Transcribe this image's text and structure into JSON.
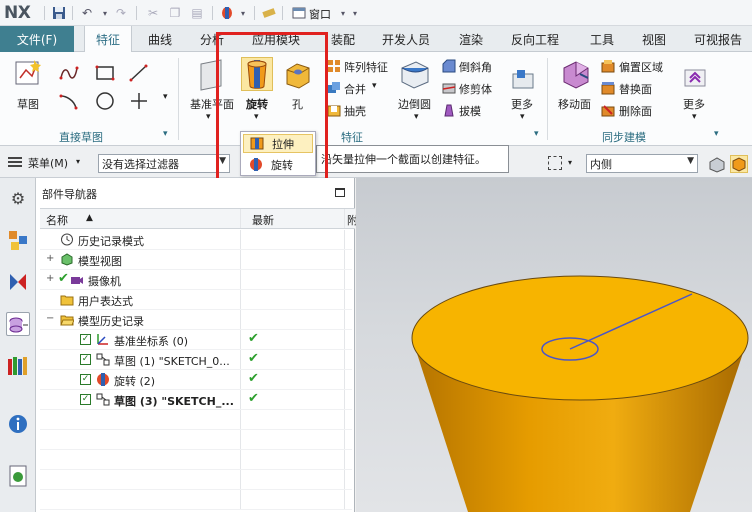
{
  "app": {
    "logo": "NX",
    "window_menu": "窗口"
  },
  "tabs": [
    "文件(F)",
    "特征",
    "曲线",
    "分析",
    "应用模块",
    "装配",
    "开发人员",
    "渲染",
    "反向工程",
    "工具",
    "视图",
    "可视报告"
  ],
  "ribbon": {
    "sketch_label": "草图",
    "direct_sketch_group": "直接草图",
    "datum_plane_label": "基准平面",
    "revolve_label": "旋转",
    "hole_label": "孔",
    "array_feature": "阵列特征",
    "unite": "合并",
    "shell": "抽壳",
    "edge_blend": "边倒圆",
    "chamfer": "倒斜角",
    "trim_body": "修剪体",
    "draft": "拔模",
    "more1": "更多",
    "feature_group": "特征",
    "move_face": "移动面",
    "offset_region": "偏置区域",
    "replace_face": "替换面",
    "delete_face": "删除面",
    "more2": "更多",
    "sync_group": "同步建模"
  },
  "dropdown": {
    "items": [
      "拉伸",
      "旋转"
    ]
  },
  "tooltip": "沿矢量拉伸一个截面以创建特征。",
  "selbar": {
    "menu": "菜单(M)",
    "filter": "没有选择过滤器",
    "scope": "内侧"
  },
  "navigator": {
    "title": "部件导航器",
    "col_name": "名称",
    "col_latest": "最新",
    "col_extra": "附",
    "rows": [
      {
        "label": "历史记录模式",
        "checked": false,
        "latest": false
      },
      {
        "label": "模型视图",
        "checked": false,
        "latest": false
      },
      {
        "label": "摄像机",
        "checked": false,
        "latest": false
      },
      {
        "label": "用户表达式",
        "checked": false,
        "latest": false
      },
      {
        "label": "模型历史记录",
        "checked": false,
        "latest": false
      },
      {
        "label": "基准坐标系 (0)",
        "checked": true,
        "latest": true
      },
      {
        "label": "草图 (1) \"SKETCH_0...",
        "checked": true,
        "latest": true
      },
      {
        "label": "旋转 (2)",
        "checked": true,
        "latest": true
      },
      {
        "label": "草图 (3) \"SKETCH_...",
        "checked": true,
        "latest": true
      }
    ]
  },
  "colors": {
    "file_tab": "#3f7f90",
    "accent_red": "#e0211f",
    "model_yellow": "#f5b300",
    "sketch_blue": "#4a55c8"
  }
}
